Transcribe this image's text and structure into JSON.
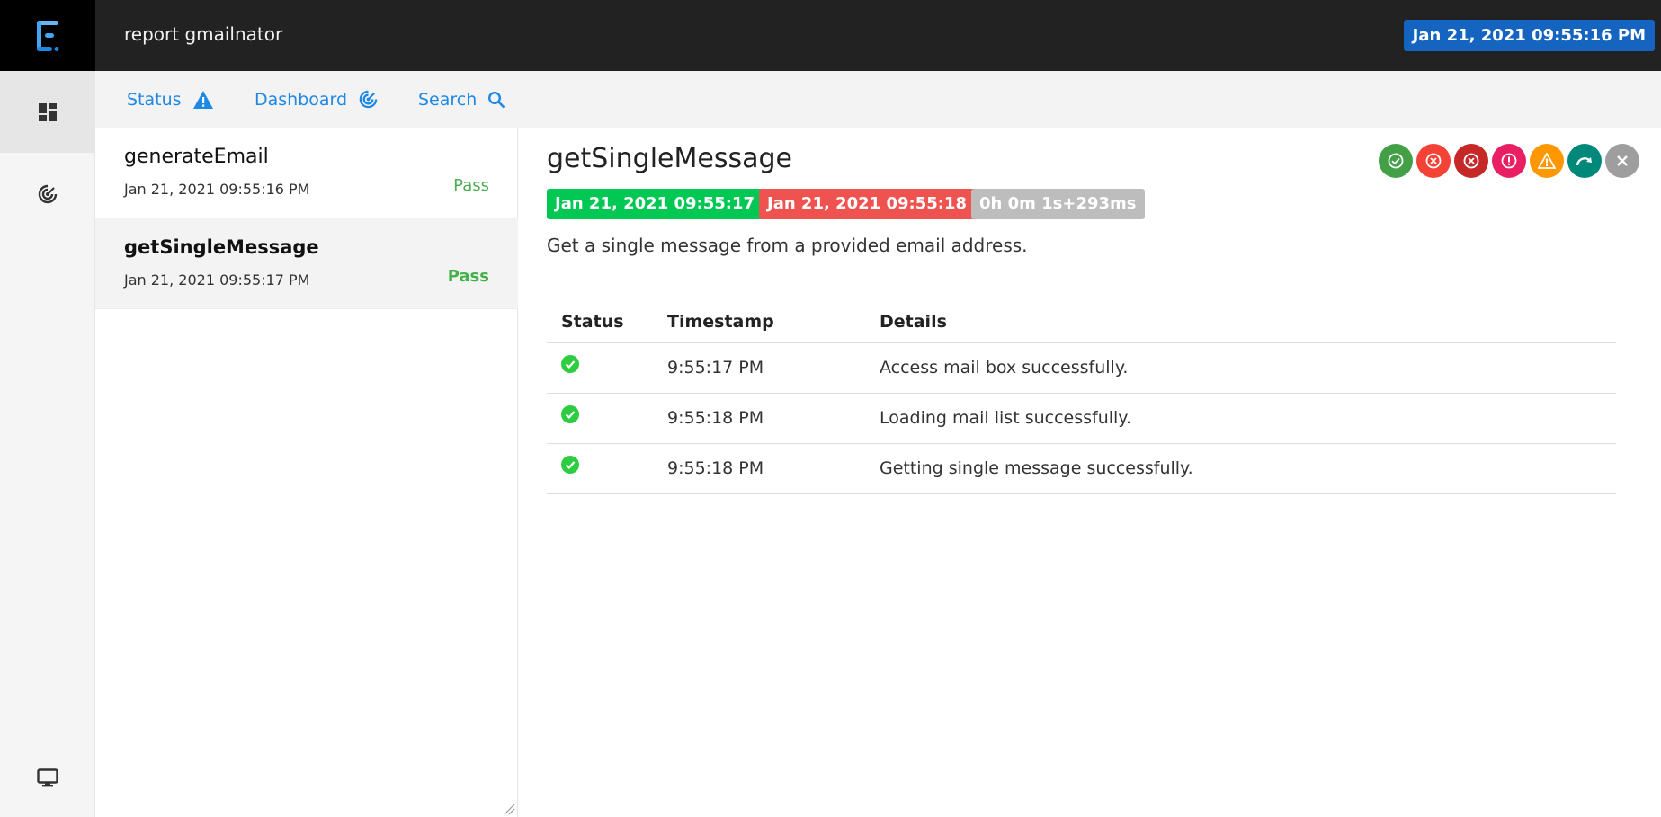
{
  "header": {
    "app_title": "report gmailnator",
    "date": "Jan 21, 2021 09:55:16 PM",
    "logo_icon": "extent-logo-icon"
  },
  "leftnav": {
    "items": [
      {
        "icon": "dashboard-grid-icon"
      },
      {
        "icon": "radar-target-icon"
      },
      {
        "icon": "monitor-icon"
      }
    ]
  },
  "subnav": {
    "status_label": "Status",
    "dashboard_label": "Dashboard",
    "search_label": "Search"
  },
  "tests": [
    {
      "name": "generateEmail",
      "time": "Jan 21, 2021 09:55:16 PM",
      "status": "Pass"
    },
    {
      "name": "getSingleMessage",
      "time": "Jan 21, 2021 09:55:17 PM",
      "status": "Pass"
    }
  ],
  "detail": {
    "title": "getSingleMessage",
    "start": "Jan 21, 2021 09:55:17 PM",
    "end": "Jan 21, 2021 09:55:18 PM",
    "duration": "0h 0m 1s+293ms",
    "description": "Get a single message from a provided email address.",
    "filters": [
      {
        "icon": "pass-check-icon",
        "color": "#43a047"
      },
      {
        "icon": "fail-x-icon",
        "color": "#f44336"
      },
      {
        "icon": "fatal-x-icon",
        "color": "#c62828"
      },
      {
        "icon": "error-exclamation-icon",
        "color": "#e91e63"
      },
      {
        "icon": "warning-triangle-icon",
        "color": "#ff9800"
      },
      {
        "icon": "skip-arrow-icon",
        "color": "#00897b"
      },
      {
        "icon": "clear-x-icon",
        "color": "#9e9e9e"
      }
    ],
    "table": {
      "headers": [
        "Status",
        "Timestamp",
        "Details"
      ],
      "rows": [
        {
          "status_icon": "pass-check-icon",
          "timestamp": "9:55:17 PM",
          "details": "Access mail box successfully."
        },
        {
          "status_icon": "pass-check-icon",
          "timestamp": "9:55:18 PM",
          "details": "Loading mail list successfully."
        },
        {
          "status_icon": "pass-check-icon",
          "timestamp": "9:55:18 PM",
          "details": "Getting single message successfully."
        }
      ]
    }
  },
  "colors": {
    "header_bg": "#222222",
    "accent_blue": "#1e88e5",
    "date_badge": "#1565c0",
    "pass_green": "#43b04a",
    "start_green": "#00c853",
    "end_red": "#ef5350",
    "duration_grey": "#bdbdbd"
  }
}
